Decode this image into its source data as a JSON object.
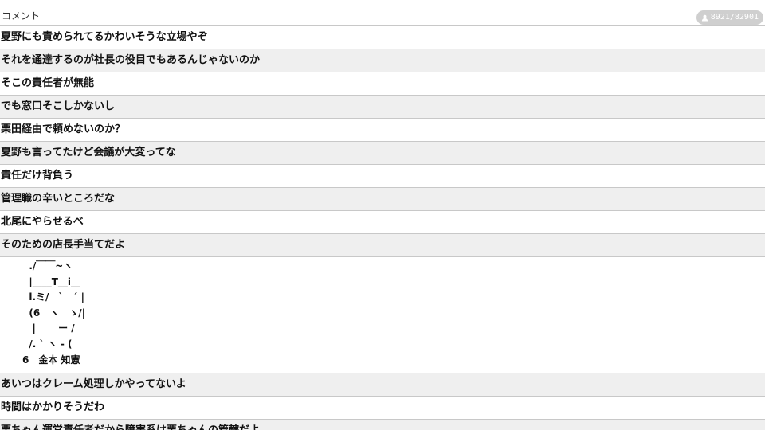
{
  "header": {
    "title": "コメント",
    "viewer_count": "8921/82901"
  },
  "comments_before_art": [
    "夏野にも責められてるかわいそうな立場やぞ",
    "それを通達するのが社長の役目でもあるんじゃないのか",
    "そこの責任者が無能",
    "でも窓口そこしかないし",
    "栗田経由で頼めないのか？",
    "夏野も言ってたけど会議が大変ってな",
    "責任だけ背負う",
    "管理職の辛いところだな",
    "北尾にやらせるべ",
    "そのための店長手当てだよ"
  ],
  "ascii_art": {
    "lines": [
      "  ./￣￣~ヽ",
      "  |____T__i__",
      "  l.ミ/　`　´ |",
      "  (6　ヽ　ゝ/|",
      "   |　　 ー /",
      "  /. ` ヽ - (",
      "6　金本 知憲"
    ]
  },
  "comments_after_art": [
    "あいつはクレーム処理しかやってないよ",
    "時間はかかりそうだわ",
    "栗ちゃん運営責任者だから障害系は栗ちゃんの管轄だよ"
  ],
  "icons": {
    "viewer": "person-icon"
  },
  "colors": {
    "row_alt": "#efefef",
    "badge": "#cfcfcf",
    "divider": "#c8c8c8"
  }
}
